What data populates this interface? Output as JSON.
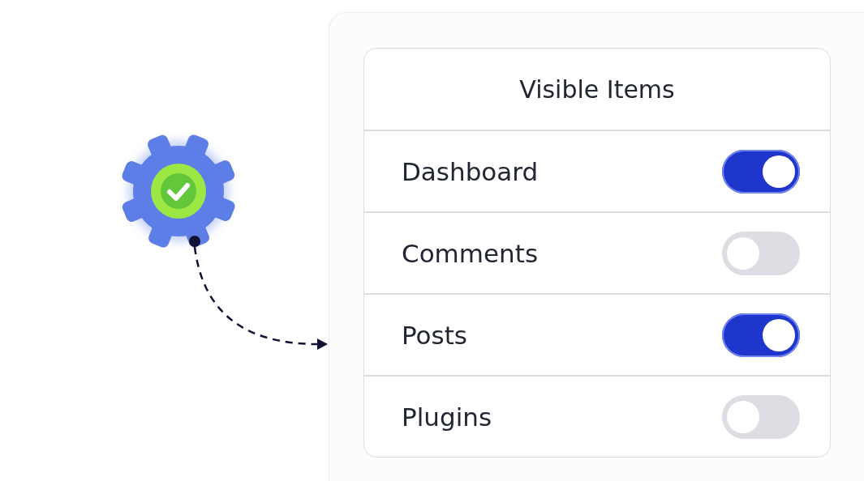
{
  "panel": {
    "title": "Visible Items",
    "items": [
      {
        "label": "Dashboard",
        "on": true
      },
      {
        "label": "Comments",
        "on": false
      },
      {
        "label": "Posts",
        "on": true
      },
      {
        "label": "Plugins",
        "on": false
      }
    ]
  }
}
